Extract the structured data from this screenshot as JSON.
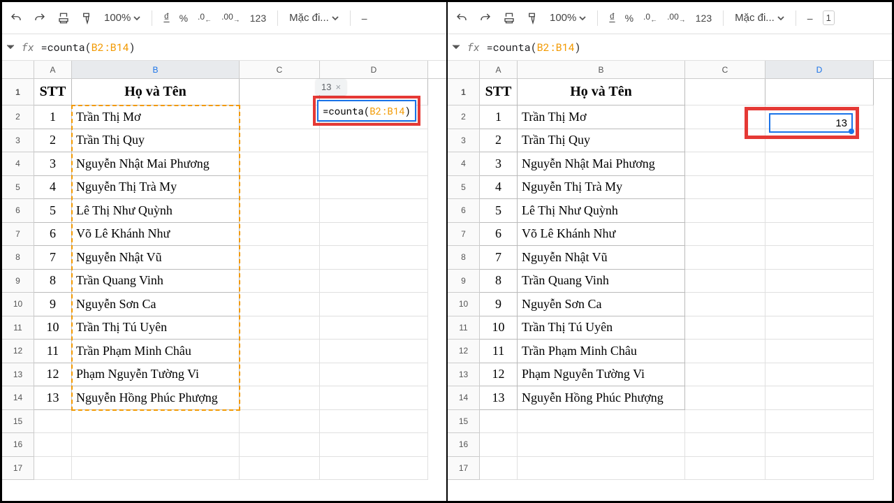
{
  "toolbar": {
    "zoom": "100%",
    "currency_symbol": "₫",
    "percent": "%",
    "dec_dec": ".0",
    "dec_inc": ".00",
    "numfmt": "123",
    "font": "Mặc đi...",
    "minus": "–"
  },
  "formula_bar": {
    "prefix": "=counta(",
    "range": "B2:B14",
    "suffix": ")"
  },
  "columns": [
    "A",
    "B",
    "C",
    "D"
  ],
  "header_row": {
    "stt": "STT",
    "hoten": "Họ và Tên"
  },
  "rows": [
    {
      "n": "1",
      "name": "Trần Thị Mơ"
    },
    {
      "n": "2",
      "name": "Trần Thị Quy"
    },
    {
      "n": "3",
      "name": "Nguyễn Nhật Mai Phương"
    },
    {
      "n": "4",
      "name": "Nguyễn Thị Trà My"
    },
    {
      "n": "5",
      "name": "Lê Thị Như Quỳnh"
    },
    {
      "n": "6",
      "name": "Võ Lê Khánh Như"
    },
    {
      "n": "7",
      "name": "Nguyễn Nhật Vũ"
    },
    {
      "n": "8",
      "name": "Trần Quang Vinh"
    },
    {
      "n": "9",
      "name": "Nguyễn Sơn Ca"
    },
    {
      "n": "10",
      "name": "Trần Thị Tú Uyên"
    },
    {
      "n": "11",
      "name": "Trần Phạm Minh Châu"
    },
    {
      "n": "12",
      "name": "Phạm Nguyễn Tường Vi"
    },
    {
      "n": "13",
      "name": "Nguyễn Hồng Phúc Phượng"
    }
  ],
  "left": {
    "hint_value": "13",
    "edit_prefix": "=counta(",
    "edit_range": "B2:B14",
    "edit_suffix": ")"
  },
  "right": {
    "result": "13"
  }
}
